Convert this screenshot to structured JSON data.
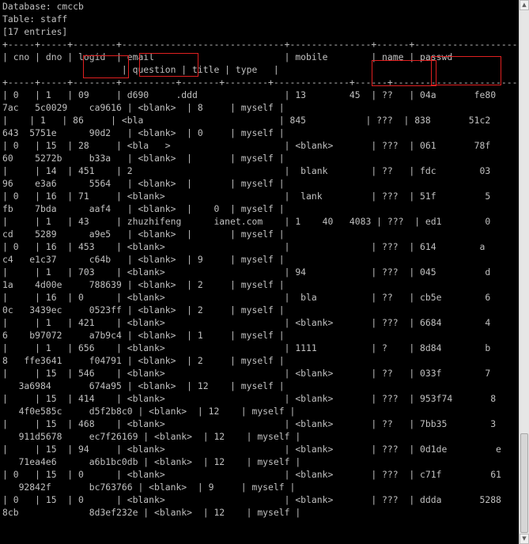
{
  "terminal": {
    "lines": [
      "Database: cmccb",
      "Table: staff",
      "[17 entries]",
      "+-----+-----+--------+------------------------------+---------------+------+---------------------------+",
      "| cno | dno | logid  | email                        | mobile        | name | passwd                    |",
      "                      | question | title | type   |",
      "+-----+-----+--------+----------+-------+--------+--------------+------+---------------------------+",
      "| 0   | 1   | 09     | d690     .ddd                | 13        45  | ??   | 04a       fe80",
      "7ac   5c0029    ca9616 | <blank>  | 8     | myself |",
      "|    | 1   | 86     | <bla                         | 845           | ???  | 838       51c2",
      "643  5751e      90d2   | <blank>  | 0     | myself |",
      "| 0   | 15  | 28     | <bla   >                     | <blank>       | ???  | 061       78f",
      "60    5272b     b33a   | <blank>  |       | myself |",
      "|     | 14  | 451    | 2                            |  blank        | ??   | fdc        03",
      "96    e3a6      5564   | <blank>  |       | myself |",
      "| 0   | 16  | 71     | <blank>                      |  lank         | ???  | 51f         5",
      "fb    7bda      aaf4   | <blank>  |    0  | myself |",
      "|     | 1   | 43     | zhuzhifeng      ianet.com    | 1    40   4083 | ???  | ed1        0",
      "cd    5289      a9e5   | <blank>  |       | myself |",
      "| 0   | 16  | 453    | <blank>                      |               | ???  | 614        a",
      "c4   e1c37      c64b   | <blank>  | 9     | myself |",
      "|     | 1   | 703    | <blank>                      | 94            | ???  | 045         d",
      "1a    4d00e     788639 | <blank>  | 2     | myself |",
      "|     | 16  | 0      | <blank>                      |  bla          | ??   | cb5e        6",
      "0c   3439ec     0523ff | <blank>  | 2     | myself |",
      "|     | 1   | 421    | <blank>                      | <blank>       | ???  | 6684        4",
      "6    b97072     a7b9c4 | <blank>  | 1     | myself |",
      "|     | 1   | 656    | <blank>                      | 1111          | ?    | 8d84        b",
      "8   ffe3641     f04791 | <blank>  | 2     | myself |",
      "|     | 15  | 546    | <blank>                      | <blank>       | ??   | 033f        7",
      "   3a6984       674a95 | <blank>  | 12    | myself |",
      "|     | 15  | 414    | <blank>                      | <blank>       | ???  | 953f74       8",
      "   4f0e585c     d5f2b8c0 | <blank>  | 12    | myself |",
      "|     | 15  | 468    | <blank>                      | <blank>       | ??   | 7bb35        3",
      "   911d5678     ec7f26169 | <blank>  | 12    | myself |",
      "|     | 15  | 94     | <blank>                      | <blank>       | ???  | 0d1de         e",
      "   71ea4e6      a6b1bc0db | <blank>  | 12    | myself |",
      "| 0   | 15  | 0      | <blank>                      | <blank>       | ???  | c71f         61",
      "   92842f       bc763766 | <blank>  | 9     | myself |",
      "| 0   | 15  | 0      | <blank>                      | <blank>       | ???  | ddda       5288",
      "8cb             8d3ef232e | <blank>  | 12    | myself |"
    ]
  }
}
